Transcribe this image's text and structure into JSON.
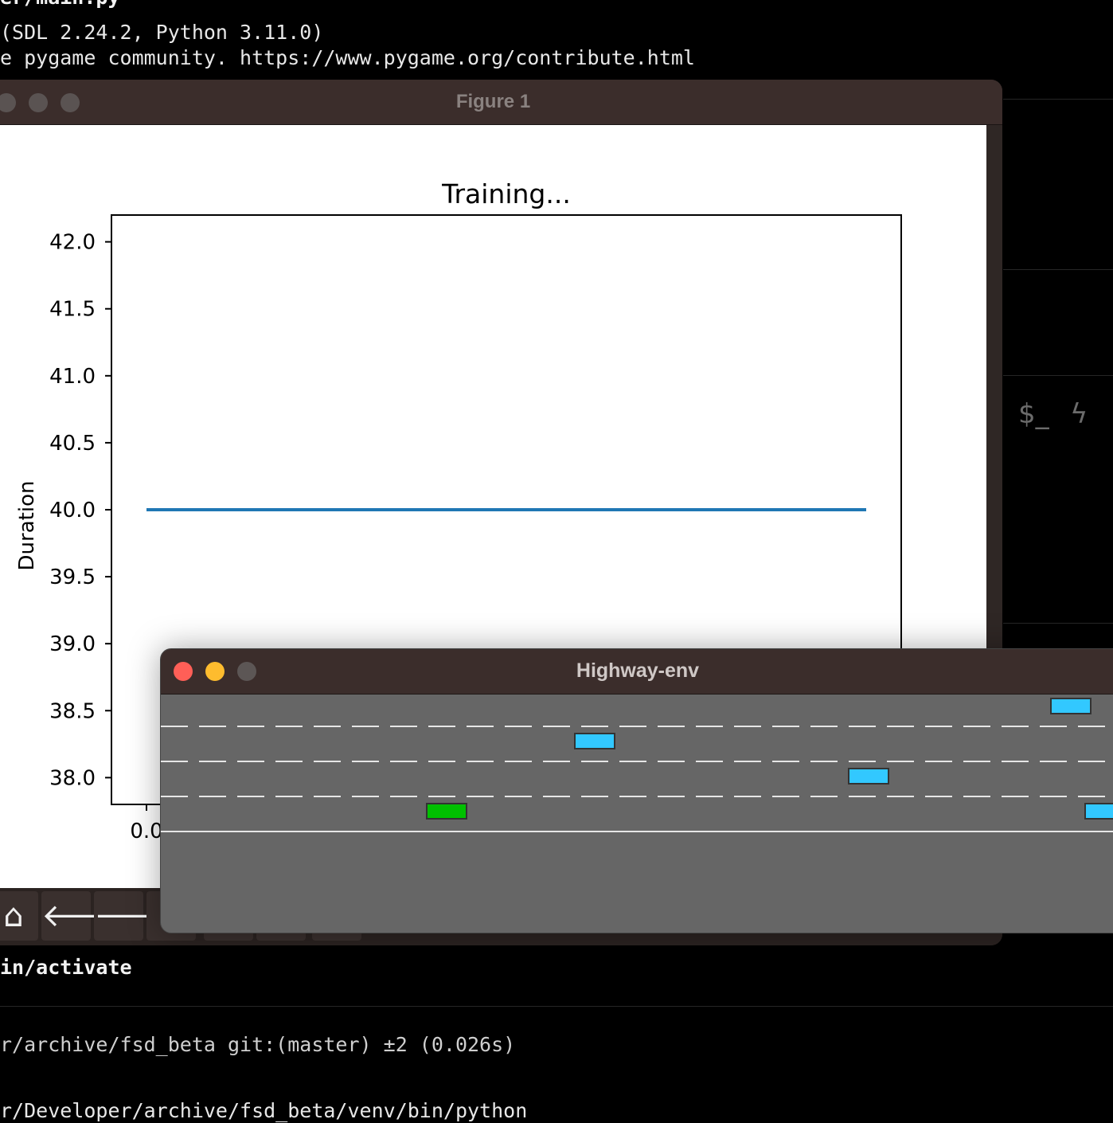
{
  "terminal": {
    "lines_top": [
      "er/main.py",
      "(SDL 2.24.2, Python 3.11.0)",
      "e pygame community. https://www.pygame.org/contribute.html"
    ],
    "lines_bottom": [
      "in/activate",
      "r/archive/fsd_beta git:(master) ±2 (0.026s)",
      "r/Developer/archive/fsd_beta/venv/bin/python"
    ],
    "side_icons": [
      "$_",
      "ϟ"
    ]
  },
  "figure_window": {
    "title": "Figure 1",
    "toolbar": [
      {
        "icon": "home-icon",
        "glyph": "⌂"
      },
      {
        "icon": "back-arrow-icon",
        "glyph": "🡐"
      },
      {
        "icon": "forward-arrow-icon",
        "glyph": "🡒"
      }
    ]
  },
  "chart_data": {
    "type": "line",
    "title": "Training...",
    "xlabel": "",
    "ylabel": "Duration",
    "ylim": [
      37.8,
      42.2
    ],
    "yticks": [
      "38.0",
      "38.5",
      "39.0",
      "39.5",
      "40.0",
      "40.5",
      "41.0",
      "41.5",
      "42.0"
    ],
    "xticks_visible": [
      "0.0"
    ],
    "series": [
      {
        "x": [
          0,
          1
        ],
        "y": [
          40.0,
          40.0
        ],
        "color": "#1f77b4"
      }
    ],
    "grid": false
  },
  "highway_window": {
    "title": "Highway-env",
    "road_color": "#646464",
    "ego_vehicle_color": "#00c000",
    "other_vehicle_color": "#32c8ff"
  },
  "colors": {
    "terminal_bg": "#000000",
    "titlebar": "#3b2d2b",
    "close": "#ff5f57",
    "minimize": "#febc2e"
  }
}
